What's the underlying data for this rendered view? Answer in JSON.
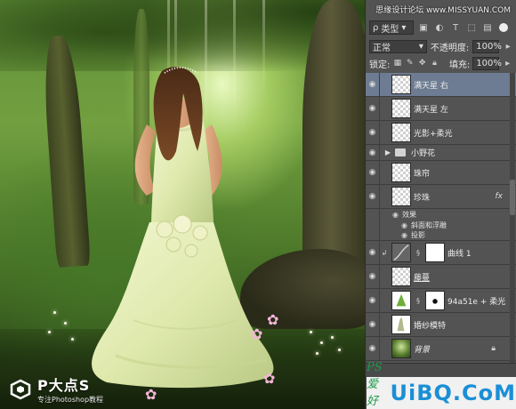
{
  "watermark_top": "思缘设计论坛 www.MISSYUAN.COM",
  "canvas": {
    "watermark_left": {
      "title": "P大点S",
      "subtitle": "专注Photoshop教程"
    }
  },
  "layers_panel": {
    "filter": {
      "kind_label": "类型",
      "search_glyph": "ρ"
    },
    "blend_mode": "正常",
    "opacity_label": "不透明度:",
    "opacity_value": "100%",
    "lock_label": "锁定:",
    "fill_label": "填充:",
    "fill_value": "100%",
    "layers": [
      {
        "name": "满天星 右",
        "selected": true
      },
      {
        "name": "满天星 左"
      },
      {
        "name": "光影+柔光"
      },
      {
        "name": "小野花",
        "group": true
      },
      {
        "name": "珠帘"
      },
      {
        "name": "珍珠",
        "fx": "fx"
      },
      {
        "name": "曲线 1"
      },
      {
        "name": "藤蔓"
      },
      {
        "name": "94a51e + 柔光"
      },
      {
        "name": "婚纱模特"
      },
      {
        "name": "背景",
        "locked": true
      }
    ],
    "effects": {
      "label": "效果",
      "items": [
        "斜面和浮雕",
        "投影"
      ]
    }
  },
  "watermark_right": {
    "brand": "UiBQ.CoM",
    "tag": "PS爱好者"
  },
  "colors": {
    "panel_bg": "#535353",
    "selected_layer": "#6d7c92",
    "brand_blue": "#1b8fd6",
    "brand_green": "#1f9a4a"
  }
}
